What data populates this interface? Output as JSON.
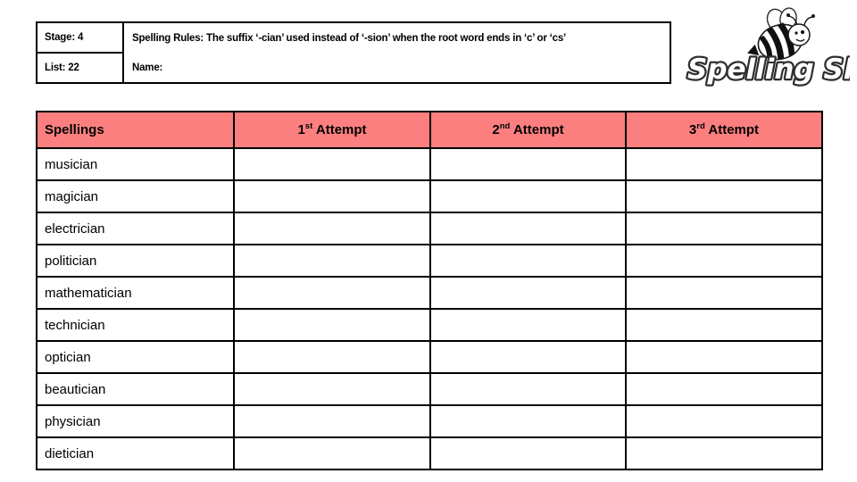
{
  "header": {
    "stage_label": "Stage: 4",
    "list_label": "List: 22",
    "rules_label": "Spelling Rules:  The suffix ‘-cian’ used instead of ‘-sion’ when the root word ends in ‘c’ or ‘cs’",
    "name_label": "Name:"
  },
  "logo": {
    "wordmark": "Spelling Shed",
    "bee_icon": "bee-icon"
  },
  "table": {
    "columns": [
      {
        "label": "Spellings",
        "ordinal": "",
        "suffix": ""
      },
      {
        "label": "Attempt",
        "ordinal": "1",
        "suffix": "st"
      },
      {
        "label": "Attempt",
        "ordinal": "2",
        "suffix": "nd"
      },
      {
        "label": "Attempt",
        "ordinal": "3",
        "suffix": "rd"
      }
    ],
    "words": [
      "musician",
      "magician",
      "electrician",
      "politician",
      "mathematician",
      "technician",
      "optician",
      "beautician",
      "physician",
      "dietician"
    ]
  },
  "colors": {
    "header_fill": "#fc7f7f",
    "border": "#000000",
    "page_background": "#ffffff"
  }
}
